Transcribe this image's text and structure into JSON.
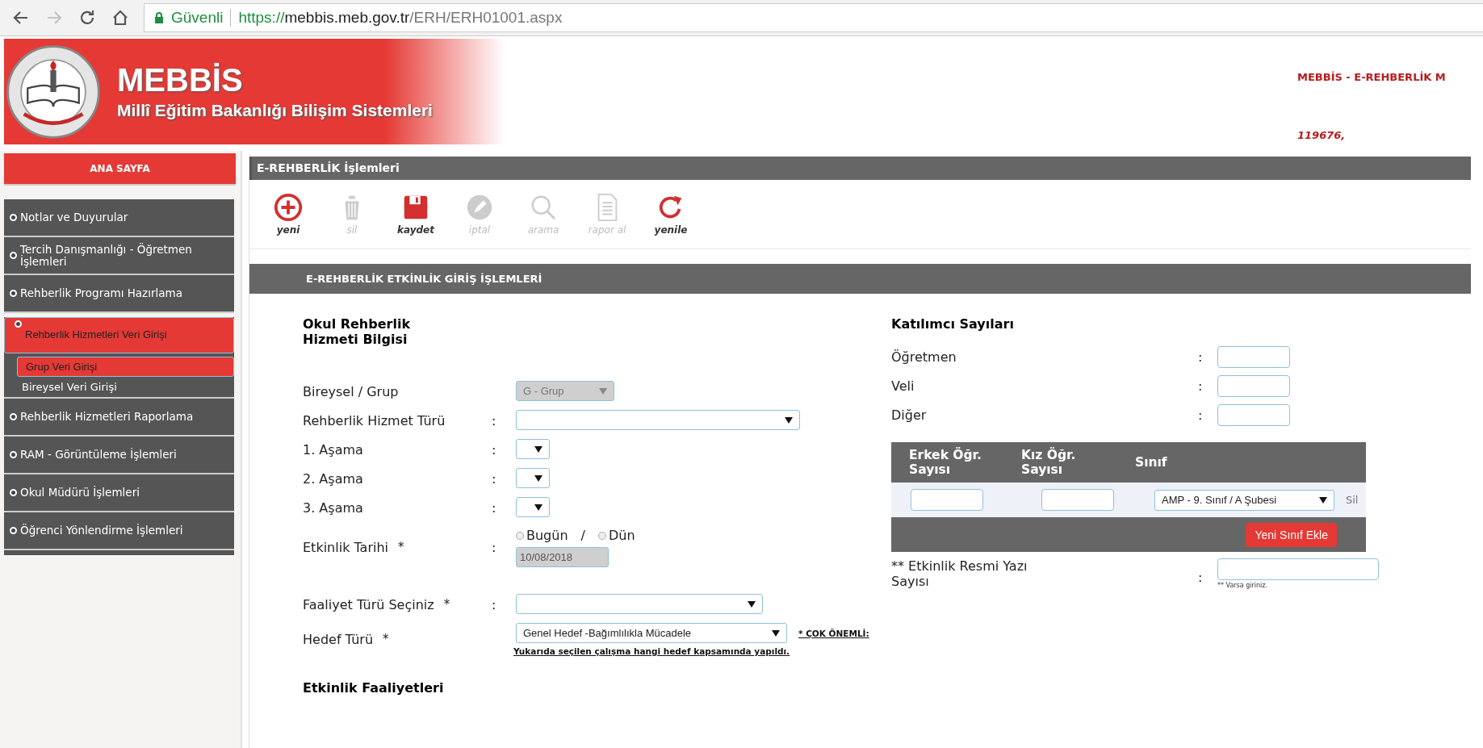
{
  "browser": {
    "security": "Güvenli",
    "url": {
      "scheme": "https://",
      "host": "mebbis.meb.gov.tr",
      "path": "/ERH/ERH01001.aspx"
    },
    "nav": [
      {
        "disabled": false
      },
      {
        "disabled": true
      },
      {
        "disabled": false
      },
      {
        "disabled": false
      }
    ]
  },
  "header": {
    "title": "MEBBİS",
    "subtitle": "Millî Eğitim Bakanlığı Bilişim Sistemleri",
    "system": "MEBBİS - E-REHBERLİK M",
    "user": "119676,"
  },
  "sidebar": {
    "home": "ANA SAYFA",
    "items": [
      {
        "label": "Notlar ve Duyurular",
        "selected": false
      },
      {
        "label": "Tercih Danışmanlığı - Öğretmen İşlemleri",
        "selected": false
      },
      {
        "label": "Rehberlik Programı Hazırlama",
        "selected": false
      },
      {
        "label": "Rehberlik Hizmetleri Veri Girişi",
        "selected": true,
        "children": [
          {
            "label": "Grup Veri Girişi",
            "selected": true
          },
          {
            "label": "Bireysel Veri Girişi",
            "selected": false
          }
        ]
      },
      {
        "label": "Rehberlik Hizmetleri Raporlama",
        "selected": false
      },
      {
        "label": "RAM - Görüntüleme İşlemleri",
        "selected": false
      },
      {
        "label": "Okul Müdürü İşlemleri",
        "selected": false
      },
      {
        "label": "Öğrenci Yönlendirme İşlemleri",
        "selected": false
      }
    ]
  },
  "panel_title": "E-REHBERLİK İşlemleri",
  "toolbar": [
    {
      "label": "yeni",
      "disabled": false
    },
    {
      "label": "sil",
      "disabled": true
    },
    {
      "label": "kaydet",
      "disabled": false
    },
    {
      "label": "iptal",
      "disabled": true
    },
    {
      "label": "arama",
      "disabled": true
    },
    {
      "label": "rapor al",
      "disabled": true
    },
    {
      "label": "yenile",
      "disabled": false
    }
  ],
  "section_title": "E-REHBERLİK ETKİNLİK GİRİŞ İŞLEMLERİ",
  "service": {
    "heading": "Okul Rehberlik Hizmeti Bilgisi",
    "rows": [
      {
        "kind": "select",
        "label": "Bireysel / Grup",
        "value": "G - Grup",
        "disabled": true
      },
      {
        "kind": "select",
        "label": "Rehberlik Hizmet Türü",
        "colon": ":",
        "disabled": false
      },
      {
        "kind": "select",
        "label": "1. Aşama",
        "colon": ":",
        "disabled": false
      },
      {
        "kind": "select",
        "label": "2. Aşama",
        "colon": ":",
        "disabled": false
      },
      {
        "kind": "select",
        "label": "3. Aşama",
        "colon": ":",
        "disabled": false
      },
      {
        "kind": "date",
        "label": "Etkinlik Tarihi",
        "required": "*",
        "colon": ":",
        "options": [
          {
            "label": "Bugün",
            "checked": false
          },
          {
            "label": "Dün",
            "checked": false
          }
        ],
        "separator": "/",
        "value": "10/08/2018",
        "disabled": true
      },
      {
        "kind": "select",
        "label": "Faaliyet Türü Seçiniz",
        "required": "*",
        "colon": ":",
        "disabled": false
      },
      {
        "kind": "select",
        "label": "Hedef Türü",
        "required": "*",
        "value": "Genel Hedef -Bağımlılıkla Mücadele",
        "disabled": false,
        "note": "* ÇOK ÖNEMLİ:",
        "help": "Yukarıda seçilen çalışma hangi hedef kapsamında yapıldı."
      }
    ],
    "activities_heading": "Etkinlik Faaliyetleri"
  },
  "participants": {
    "heading": "Katılımcı Sayıları",
    "rows": [
      {
        "label": "Öğretmen",
        "colon": ":"
      },
      {
        "label": "Veli",
        "colon": ":"
      },
      {
        "label": "Diğer",
        "colon": ":"
      }
    ],
    "table": {
      "columns": [
        "Erkek Öğr. Sayısı",
        "Kız Öğr. Sayısı",
        "Sınıf"
      ],
      "rows": [
        {
          "class": "AMP - 9. Sınıf / A Şubesi",
          "remove": "Sil"
        }
      ],
      "add_button": "Yeni Sınıf Ekle"
    },
    "letter": {
      "label": "** Etkinlik Resmi Yazı Sayısı",
      "colon": ":",
      "hint": "** Varsa giriniz."
    }
  }
}
